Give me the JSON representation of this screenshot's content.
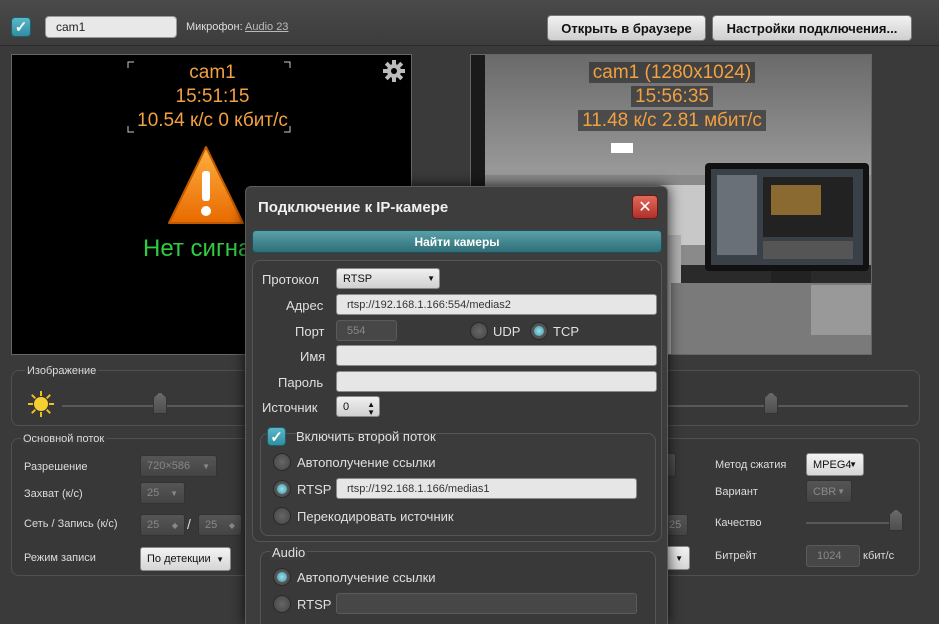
{
  "topbar": {
    "camera_name": "cam1",
    "mic_label": "Микрофон:",
    "mic_value": "Audio 23",
    "open_browser": "Открыть в браузере",
    "connection_settings": "Настройки подключения..."
  },
  "left_video": {
    "name": "cam1",
    "time": "15:51:15",
    "stats": "10.54 к/с 0 кбит/с",
    "no_signal": "Нет сигна"
  },
  "right_video": {
    "name": "cam1 (1280x1024)",
    "time": "15:56:35",
    "stats": "11.48 к/с 2.81 мбит/с"
  },
  "image_section": {
    "title": "Изображение"
  },
  "main_stream": {
    "title": "Основной поток",
    "resolution_label": "Разрешение",
    "resolution_value": "720×586",
    "capture_label": "Захват (к/с)",
    "capture_value": "25",
    "net_rec_label": "Сеть / Запись (к/с)",
    "net_value": "25",
    "rec_value": "25",
    "slash": "/",
    "rec_mode_label": "Режим записи",
    "rec_mode_value": "По детекции",
    "compression_label": "Метод сжатия",
    "compression_value": "MPEG4",
    "variant_label": "Вариант",
    "variant_value": "CBR",
    "quality_label": "Качество",
    "bitrate_label": "Битрейт",
    "bitrate_value": "1024",
    "bitrate_unit": "кбит/с",
    "hidden_value": "25"
  },
  "dialog": {
    "title": "Подключение к IP-камере",
    "close": "✕",
    "find_cameras": "Найти камеры",
    "protocol_label": "Протокол",
    "protocol_value": "RTSP",
    "address_label": "Адрес",
    "address_value": "rtsp://192.168.1.166:554/medias2",
    "port_label": "Порт",
    "port_value": "554",
    "udp_label": "UDP",
    "tcp_label": "TCP",
    "name_label": "Имя",
    "name_value": "",
    "password_label": "Пароль",
    "password_value": "",
    "source_label": "Источник",
    "source_value": "0",
    "second_stream_label": "Включить второй поток",
    "auto_link_label": "Автополучение ссылки",
    "rtsp_label": "RTSP",
    "rtsp_value": "rtsp://192.168.1.166/medias1",
    "transcode_label": "Перекодировать источник",
    "audio_title": "Audio",
    "audio_auto_label": "Автополучение ссылки",
    "audio_rtsp_label": "RTSP",
    "audio_rtsp_value": ""
  },
  "colors": {
    "osd": "#f2a040",
    "no_signal": "#2ecc40",
    "accent": "#3a9aaa",
    "close": "#c0392b"
  },
  "icons": [
    "check-icon",
    "gear-icon",
    "warning-icon",
    "sun-icon",
    "close-icon",
    "chevron-down-icon",
    "spinner-icon"
  ]
}
